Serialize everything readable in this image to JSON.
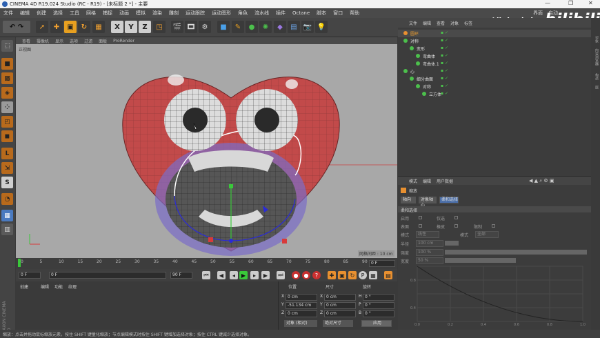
{
  "title": "CINEMA 4D R19.024 Studio (RC - R19) - [未标题 2 *] - 主要",
  "menu": [
    "文件",
    "编辑",
    "创建",
    "选择",
    "工具",
    "网格",
    "捕捉",
    "动画",
    "模拟",
    "渲染",
    "雕刻",
    "运动跟踪",
    "运动图形",
    "角色",
    "流水线",
    "插件",
    "Octane",
    "脚本",
    "窗口",
    "帮助"
  ],
  "menu_right": [
    "界面",
    "启动"
  ],
  "viewport_menu": [
    "查看",
    "摄像机",
    "显示",
    "选项",
    "过滤",
    "面板",
    "ProRender"
  ],
  "viewport_label": "正视图",
  "grid_spacing": "网格间距 : 10 cm",
  "timeline_ticks": [
    "0",
    "5",
    "10",
    "15",
    "20",
    "25",
    "30",
    "35",
    "40",
    "45",
    "50",
    "55",
    "60",
    "65",
    "70",
    "75",
    "80",
    "85",
    "90"
  ],
  "frame_end": "0 F",
  "time_fields": {
    "start": "0 F",
    "cur": "0 F",
    "end": "90 F",
    "max": "90 F"
  },
  "mat_menu": [
    "创建",
    "编辑",
    "功能",
    "纹理"
  ],
  "coord": {
    "headers": [
      "位置",
      "尺寸",
      "旋转"
    ],
    "rows": [
      {
        "axis": "X",
        "pos": "0 cm",
        "size_axis": "X",
        "size": "0 cm",
        "rot_axis": "H",
        "rot": "0 °"
      },
      {
        "axis": "Y",
        "pos": "-51.134 cm",
        "size_axis": "Y",
        "size": "0 cm",
        "rot_axis": "P",
        "rot": "0 °"
      },
      {
        "axis": "Z",
        "pos": "0 cm",
        "size_axis": "Z",
        "size": "0 cm",
        "rot_axis": "B",
        "rot": "0 °"
      }
    ],
    "mode": "对象 (相对)",
    "size_mode": "绝对尺寸",
    "apply": "应用"
  },
  "status": "缩放：点击并拖动鼠标缩放元素。按住 SHIFT 键量化缩放；节点编辑模式时按住 SHIFT 键增加选择对象；按住 CTRL 键减少选择对象。",
  "obj_menu": [
    "文件",
    "编辑",
    "查看",
    "对象",
    "标签"
  ],
  "objects": [
    {
      "name": "圆环",
      "indent": 0,
      "sel": true
    },
    {
      "name": "对称",
      "indent": 0
    },
    {
      "name": "变形",
      "indent": 1
    },
    {
      "name": "弯曲体",
      "indent": 2
    },
    {
      "name": "弯曲体.1",
      "indent": 2
    },
    {
      "name": "心",
      "indent": 0
    },
    {
      "name": "细分曲面",
      "indent": 1
    },
    {
      "name": "对称",
      "indent": 2
    },
    {
      "name": "立方体",
      "indent": 3
    }
  ],
  "attr_menu": [
    "模式",
    "编辑",
    "用户数据"
  ],
  "attr_title": "缩放",
  "attr_tabs": [
    "轴向",
    "对象轴心",
    "柔和选择"
  ],
  "attr_section": "柔和选择",
  "attr_fields": [
    {
      "l": "启用",
      "v": ""
    },
    {
      "l": "仅选",
      "v": ""
    },
    {
      "l": "表面",
      "v": ""
    },
    {
      "l": "橡皮",
      "v": ""
    },
    {
      "l": "限制",
      "v": ""
    },
    {
      "l": "模式",
      "v": "线性"
    },
    {
      "l": "模式",
      "v": "全部"
    },
    {
      "l": "半径",
      "v": "100 cm"
    },
    {
      "l": "强度",
      "v": "100 %"
    },
    {
      "l": "宽度",
      "v": "50 %"
    }
  ],
  "graph_x": [
    "0.0",
    "0.2",
    "0.4",
    "0.6",
    "0.8",
    "1.0"
  ],
  "graph_y": [
    "0.8",
    "0.4"
  ],
  "watermark": "不错实验室",
  "bili": "bilibili",
  "side_labels": [
    "对象",
    "内容浏览器",
    "构造",
    "层"
  ],
  "maxon": "MAXON CINEMA 4D"
}
